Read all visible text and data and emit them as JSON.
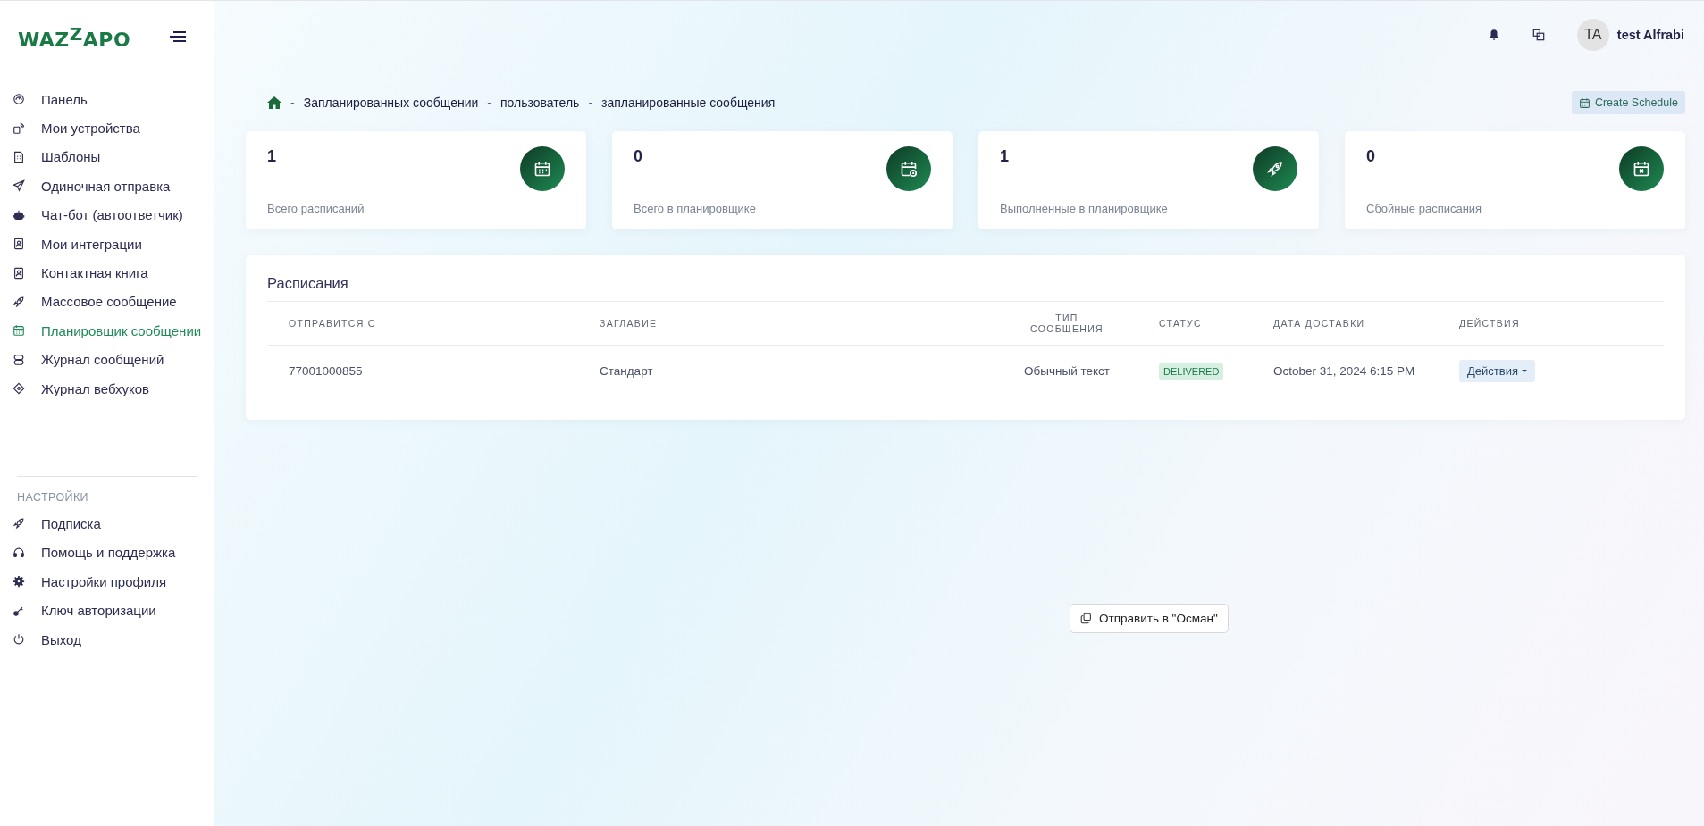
{
  "logo": {
    "text_a": "WAZ",
    "text_raised": "Z",
    "text_b": "APO"
  },
  "header": {
    "avatar": "TA",
    "user": "test Alfrabi"
  },
  "sidebar": {
    "items": [
      {
        "label": "Панель",
        "selected": false
      },
      {
        "label": "Мои устройства",
        "selected": false
      },
      {
        "label": "Шаблоны",
        "selected": false
      },
      {
        "label": "Одиночная отправка",
        "selected": false
      },
      {
        "label": "Чат-бот (автоответчик)",
        "selected": false
      },
      {
        "label": "Мои интеграции",
        "selected": false
      },
      {
        "label": "Контактная книга",
        "selected": false
      },
      {
        "label": "Массовое сообщение",
        "selected": false
      },
      {
        "label": "Планировщик сообщении",
        "selected": true
      },
      {
        "label": "Журнал сообщений",
        "selected": false
      },
      {
        "label": "Журнал вебхуков",
        "selected": false
      }
    ],
    "settings_heading": "НАСТРОЙКИ",
    "settings_items": [
      {
        "label": "Подписка",
        "selected": false
      },
      {
        "label": "Помощь и поддержка",
        "selected": false
      },
      {
        "label": "Настройки профиля",
        "selected": false
      },
      {
        "label": "Ключ авторизации",
        "selected": false
      },
      {
        "label": "Выход",
        "selected": false
      }
    ]
  },
  "breadcrumb_separator": "-",
  "breadcrumb": [
    "Запланированных сообщении",
    "пользователь",
    "запланированные сообщения"
  ],
  "create_button": "Create Schedule",
  "stats": [
    {
      "value": "1",
      "label": "Всего расписаний"
    },
    {
      "value": "0",
      "label": "Всего в планировщике"
    },
    {
      "value": "1",
      "label": "Выполненные в планировщике"
    },
    {
      "value": "0",
      "label": "Сбойные расписания"
    }
  ],
  "table": {
    "title": "Расписания",
    "columns": [
      "ОТПРАВИТСЯ С",
      "ЗАГЛАВИЕ",
      "ТИП СООБЩЕНИЯ",
      "СТАТУС",
      "ДАТА ДОСТАВКИ",
      "ДЕЙСТВИЯ"
    ],
    "rows": [
      {
        "from": "77001000855",
        "title": "Стандарт",
        "type": "Обычный текст",
        "status": "DELIVERED",
        "date": "October 31, 2024 6:15 PM",
        "action": "Действия"
      }
    ]
  },
  "floating_button": "Отправить в \"Осман\""
}
